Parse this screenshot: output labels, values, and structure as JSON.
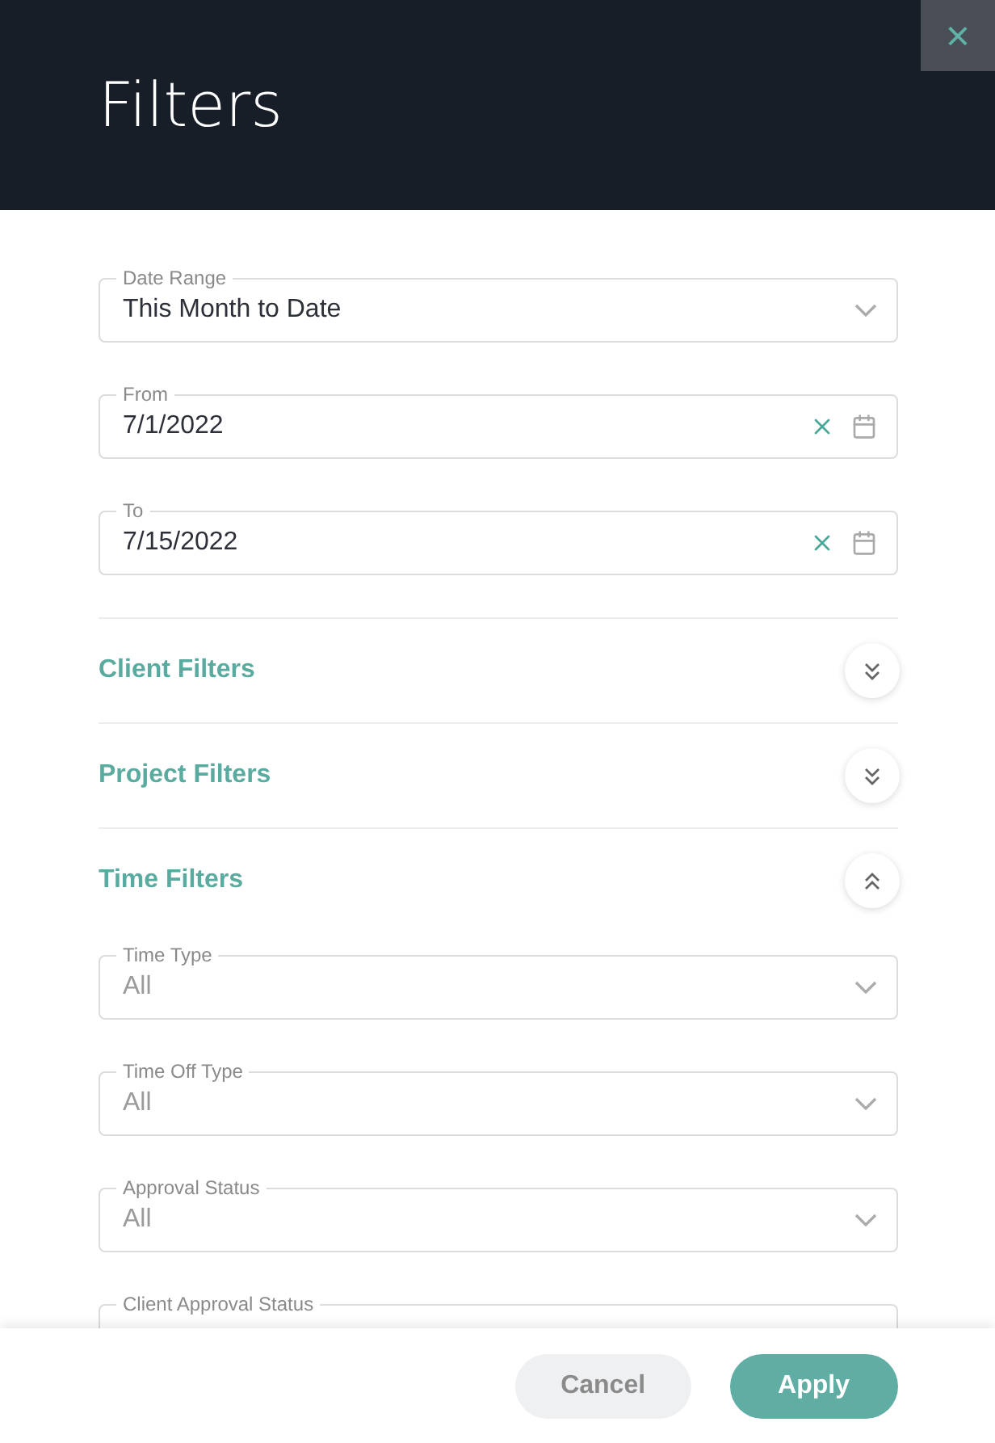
{
  "header": {
    "title": "Filters",
    "close": "×"
  },
  "fields": [
    {
      "kind": "select",
      "label": "Date Range",
      "value": "This Month to Date"
    },
    {
      "kind": "date",
      "label": "From",
      "value": "7/1/2022"
    },
    {
      "kind": "date",
      "label": "To",
      "value": "7/15/2022"
    }
  ],
  "sections": [
    {
      "title": "Client Filters",
      "expanded": false
    },
    {
      "title": "Project Filters",
      "expanded": false
    },
    {
      "title": "Time Filters",
      "expanded": true,
      "fields": [
        {
          "kind": "select",
          "label": "Time Type",
          "placeholder": "All"
        },
        {
          "kind": "select",
          "label": "Time Off Type",
          "placeholder": "All"
        },
        {
          "kind": "select",
          "label": "Approval Status",
          "placeholder": "All"
        },
        {
          "kind": "select",
          "label": "Client Approval Status"
        }
      ]
    }
  ],
  "footer": {
    "buttons": [
      {
        "label": "Cancel",
        "kind": "secondary"
      },
      {
        "label": "Apply",
        "kind": "primary"
      }
    ]
  }
}
